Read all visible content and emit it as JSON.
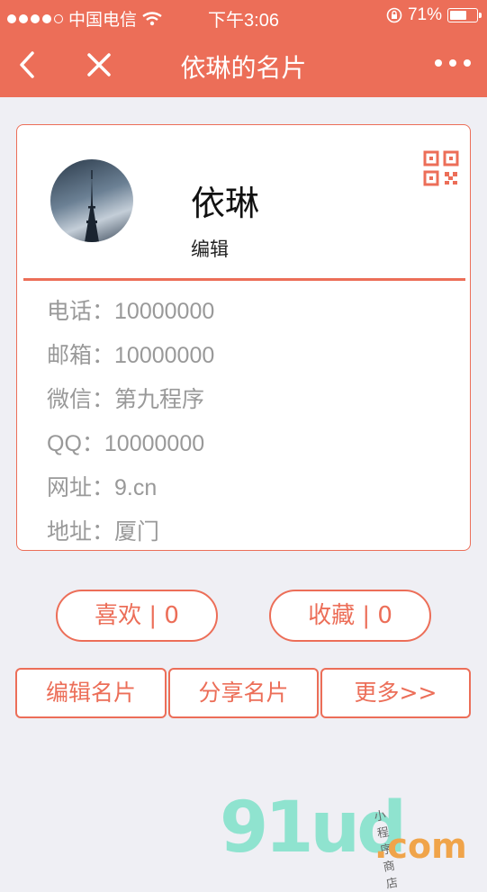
{
  "status": {
    "carrier": "中国电信",
    "time": "下午3:06",
    "battery_text": "71%",
    "battery_level": 0.71
  },
  "nav": {
    "title": "依琳的名片"
  },
  "card": {
    "name": "依琳",
    "edit": "编辑",
    "rows": [
      {
        "label": "电话：",
        "value": "10000000"
      },
      {
        "label": "邮箱：",
        "value": "10000000"
      },
      {
        "label": "微信：",
        "value": "第九程序"
      },
      {
        "label": "QQ：",
        "value": "10000000"
      },
      {
        "label": "网址：",
        "value": "9.cn"
      },
      {
        "label": "地址：",
        "value": "厦门"
      }
    ]
  },
  "actions": {
    "like": "喜欢 | 0",
    "favorite": "收藏 | 0"
  },
  "buttons": {
    "edit_card": "编辑名片",
    "share_card": "分享名片",
    "more": "更多>>"
  },
  "watermark": {
    "brand": "91ud",
    "domain": ".com",
    "tagline": "小程序商店"
  },
  "colors": {
    "accent": "#ec6e58",
    "background": "#efeff4"
  }
}
